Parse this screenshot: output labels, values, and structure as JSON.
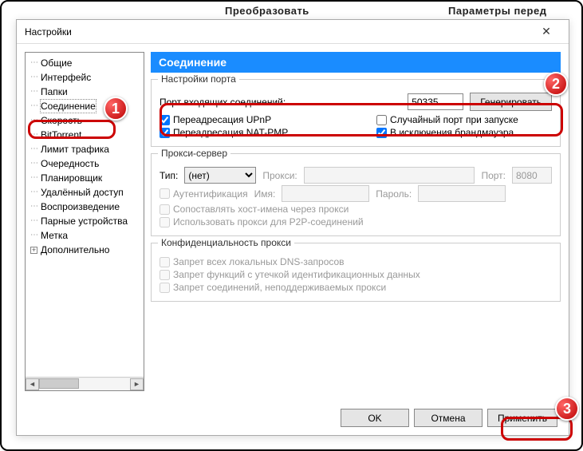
{
  "background_hints": {
    "left": "Преобразовать",
    "right": "Параметры перед"
  },
  "dialog": {
    "title": "Настройки"
  },
  "tree": {
    "items": [
      "Общие",
      "Интерфейс",
      "Папки",
      "Соединение",
      "Скорость",
      "BitTorrent",
      "Лимит трафика",
      "Очередность",
      "Планировщик",
      "Удалённый доступ",
      "Воспроизведение",
      "Парные устройства",
      "Метка",
      "Дополнительно"
    ],
    "selected_index": 3,
    "expandable_index": 13
  },
  "content": {
    "header": "Соединение",
    "port_group": {
      "title": "Настройки порта",
      "label": "Порт входящих соединений:",
      "value": "50335",
      "random_btn": "Генерировать",
      "upnp": "Переадресация UPnP",
      "natpmp": "Переадресация NAT-PMP",
      "random_start": "Случайный порт при запуске",
      "firewall": "В исключения брандмауэра"
    },
    "proxy_group": {
      "title": "Прокси-сервер",
      "type_label": "Тип:",
      "type_value": "(нет)",
      "proxy_label": "Прокси:",
      "port_label": "Порт:",
      "port_value": "8080",
      "auth": "Аутентификация",
      "name_label": "Имя:",
      "pass_label": "Пароль:",
      "hostnames": "Сопоставлять хост-имена через прокси",
      "p2p": "Использовать прокси для P2P-соединений"
    },
    "privacy_group": {
      "title": "Конфиденциальность прокси",
      "dns": "Запрет всех локальных DNS-запросов",
      "leak": "Запрет функций с утечкой идентификационных данных",
      "unsupported": "Запрет соединений, неподдерживаемых прокси"
    }
  },
  "buttons": {
    "ok": "OK",
    "cancel": "Отмена",
    "apply": "Применить"
  },
  "annotations": {
    "b1": "1",
    "b2": "2",
    "b3": "3"
  }
}
